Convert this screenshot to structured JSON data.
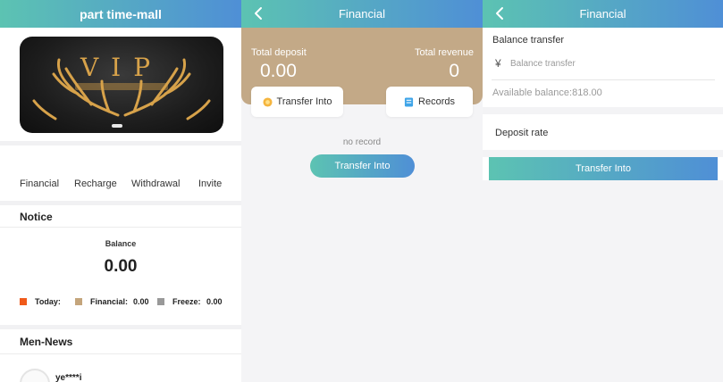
{
  "mall": {
    "title": "part time-mall",
    "banner": {
      "text": "VIP"
    },
    "nav": [
      "Financial",
      "Recharge",
      "Withdrawal",
      "Invite"
    ],
    "notice_title": "Notice",
    "balance_label": "Balance",
    "balance_value": "0.00",
    "legend": {
      "today_label": "Today:",
      "financial_label": "Financial:",
      "financial_value": "0.00",
      "freeze_label": "Freeze:",
      "freeze_value": "0.00",
      "colors": {
        "today": "#f05a1a",
        "financial": "#c4a57c",
        "freeze": "#999999"
      }
    },
    "news_title": "Men-News",
    "news_user": "ye****i"
  },
  "financial": {
    "title": "Financial",
    "total_deposit_label": "Total deposit",
    "total_deposit_value": "0.00",
    "total_revenue_label": "Total revenue",
    "total_revenue_value": "0",
    "transfer_into_label": "Transfer Into",
    "records_label": "Records",
    "no_record": "no record",
    "transfer_button": "Transfer Into"
  },
  "transfer": {
    "title": "Financial",
    "balance_transfer_label": "Balance transfer",
    "currency_symbol": "¥",
    "input_placeholder": "Balance transfer",
    "available_balance": "Available balance:818.00",
    "deposit_rate_label": "Deposit rate",
    "transfer_button": "Transfer Into"
  },
  "colors": {
    "header_gradient_start": "#5cc3b2",
    "header_gradient_end": "#4f8fd6",
    "summary_bg": "#c3a987"
  }
}
